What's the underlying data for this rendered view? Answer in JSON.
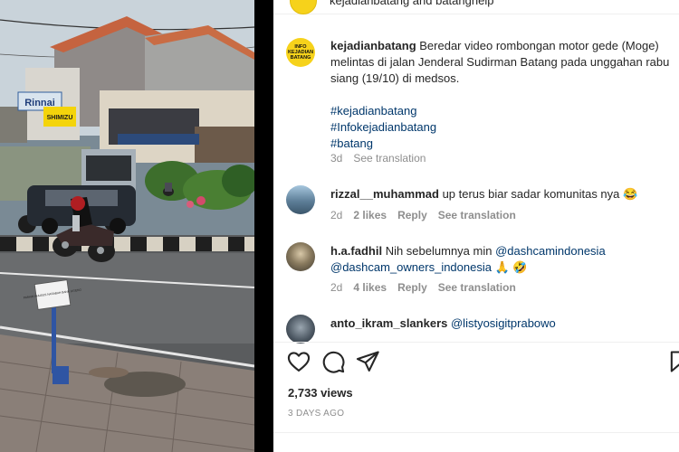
{
  "post": {
    "header_handle": "kejadianbatang and batanghelp",
    "logo_text": [
      "INFO",
      "KEJADIAN",
      "BATANG"
    ]
  },
  "caption": {
    "username": "kejadianbatang",
    "text": "Beredar video rombongan motor gede (Moge) melintas di jalan Jenderal Sudirman Batang pada unggahan rabu siang (19/10) di medsos.",
    "hashtags": [
      "#kejadianbatang",
      "#Infokejadianbatang",
      "#batang"
    ],
    "time": "3d",
    "translate": "See translation"
  },
  "comments": [
    {
      "username": "rizzal__muhammad",
      "text": "up terus biar sadar komunitas nya 😂",
      "time": "2d",
      "likes": "2 likes",
      "reply": "Reply",
      "translate": "See translation"
    },
    {
      "username": "h.a.fadhil",
      "text_before": "Nih sebelumnya min ",
      "mention1": "@dashcamindonesia",
      "mention2": "@dashcam_owners_indonesia",
      "emoji": "🙏 🤣",
      "time": "2d",
      "likes": "4 likes",
      "reply": "Reply",
      "translate": "See translation"
    },
    {
      "username": "anto_ikram_slankers",
      "mention": "@listyosigitprabowo"
    }
  ],
  "video_signs": {
    "store1": "Rinnai",
    "store2": "SHIMIZU",
    "parking": "PARKIR KHUSUS NASABAH BANK JATENG"
  },
  "footer": {
    "views": "2,733 views",
    "ago": "3 DAYS AGO"
  },
  "icons": {
    "like": "heart-outline-icon",
    "comment": "speech-bubble-icon",
    "share": "paper-plane-icon",
    "save": "bookmark-icon"
  }
}
